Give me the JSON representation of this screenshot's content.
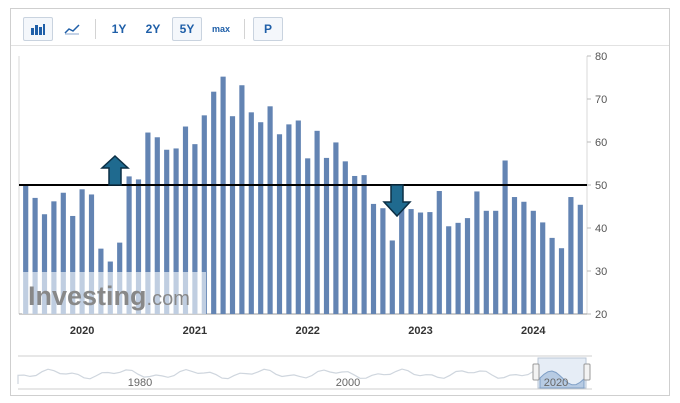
{
  "toolbar": {
    "buttons": [
      {
        "name": "bar-chart-icon",
        "label": "",
        "icon": "bar-chart-icon",
        "boxed": true
      },
      {
        "name": "line-chart-icon",
        "label": "",
        "icon": "line-chart-icon",
        "boxed": false
      },
      {
        "name": "range-1y-button",
        "label": "1Y",
        "boxed": false
      },
      {
        "name": "range-2y-button",
        "label": "2Y",
        "boxed": false
      },
      {
        "name": "range-5y-button",
        "label": "5Y",
        "boxed": true
      },
      {
        "name": "range-max-button",
        "label": "max",
        "boxed": false,
        "small": true
      },
      {
        "name": "p-button",
        "label": "P",
        "boxed": true
      }
    ]
  },
  "watermark": {
    "brand": "Investing",
    "suffix": ".com"
  },
  "chart_data": {
    "type": "bar",
    "bar_color": "#6384b3",
    "reference_line": 50,
    "ylim": [
      20,
      80
    ],
    "y_ticks": [
      20,
      30,
      40,
      50,
      60,
      70,
      80
    ],
    "x_year_labels": [
      "2020",
      "2021",
      "2022",
      "2023",
      "2024"
    ],
    "x_year_label_index": [
      6,
      18,
      30,
      42,
      54
    ],
    "values": [
      50.2,
      47,
      43.2,
      46.2,
      48.2,
      42.8,
      49,
      47.8,
      35.2,
      32.2,
      36.6,
      52,
      51.3,
      62.2,
      61.1,
      58.2,
      58.5,
      63.6,
      59.5,
      66.2,
      71.7,
      75.2,
      66,
      73.2,
      66.9,
      64.6,
      68.3,
      61.8,
      64.1,
      65,
      56.2,
      62.6,
      56.3,
      59.9,
      55.5,
      52.1,
      52.3,
      45.6,
      44.6,
      37.1,
      45.6,
      44.4,
      43.6,
      43.7,
      48.6,
      40.4,
      41.2,
      42.3,
      48.5,
      44,
      44,
      55.7,
      47.2,
      46.1,
      44,
      41.3,
      37.7,
      35.3,
      47.2,
      45.4
    ],
    "arrows": [
      {
        "direction": "up",
        "at_index": 9.5
      },
      {
        "direction": "down",
        "at_index": 39.5
      }
    ],
    "navigator": {
      "labels": [
        "1980",
        "2000",
        "2020"
      ]
    }
  }
}
